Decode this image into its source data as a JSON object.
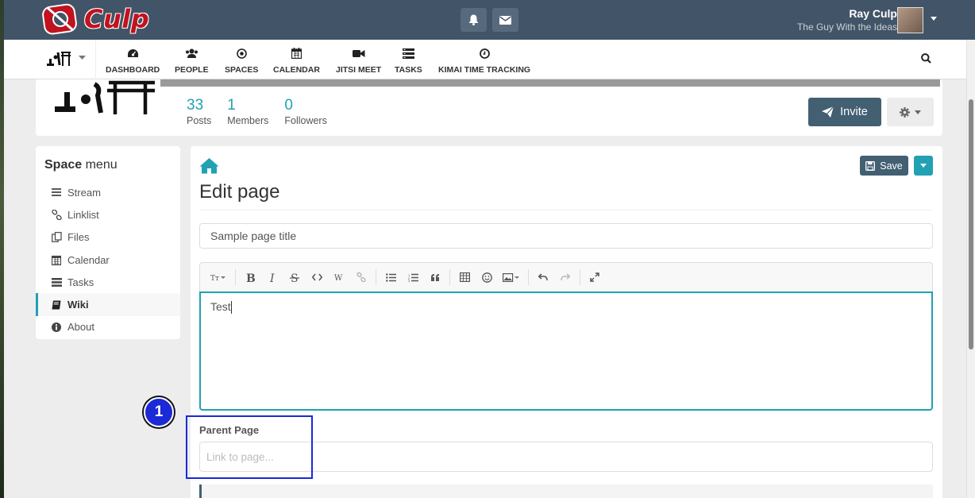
{
  "brand": {
    "name": "Culp",
    "accent": "#c1121f"
  },
  "topbar": {
    "icons": [
      "bell-icon",
      "envelope-icon"
    ],
    "user": {
      "name": "Ray Culp",
      "subtitle": "The Guy With the Ideas"
    }
  },
  "nav": {
    "items": [
      {
        "label": "DASHBOARD",
        "icon": "dashboard-icon"
      },
      {
        "label": "PEOPLE",
        "icon": "people-icon"
      },
      {
        "label": "SPACES",
        "icon": "spaces-icon"
      },
      {
        "label": "CALENDAR",
        "icon": "calendar-icon"
      },
      {
        "label": "JITSI MEET",
        "icon": "video-icon"
      },
      {
        "label": "TASKS",
        "icon": "tasks-icon"
      },
      {
        "label": "KIMAI TIME TRACKING",
        "icon": "clock-icon"
      }
    ]
  },
  "space": {
    "stats": [
      {
        "value": "33",
        "label": "Posts"
      },
      {
        "value": "1",
        "label": "Members"
      },
      {
        "value": "0",
        "label": "Followers"
      }
    ],
    "invite_label": "Invite"
  },
  "space_menu": {
    "title_bold": "Space",
    "title_rest": " menu",
    "items": [
      {
        "label": "Stream",
        "icon": "bars-icon",
        "active": false
      },
      {
        "label": "Linklist",
        "icon": "link-icon",
        "active": false
      },
      {
        "label": "Files",
        "icon": "files-icon",
        "active": false
      },
      {
        "label": "Calendar",
        "icon": "calendar-icon",
        "active": false
      },
      {
        "label": "Tasks",
        "icon": "tasks-icon",
        "active": false
      },
      {
        "label": "Wiki",
        "icon": "book-icon",
        "active": true
      },
      {
        "label": "About",
        "icon": "info-icon",
        "active": false
      }
    ]
  },
  "editor": {
    "heading": "Edit page",
    "save_label": "Save",
    "title_value": "Sample page title",
    "content": "Test",
    "parent_label": "Parent Page",
    "parent_placeholder": "Link to page..."
  },
  "annotation": {
    "step": "1",
    "color": "#1b29d6"
  }
}
